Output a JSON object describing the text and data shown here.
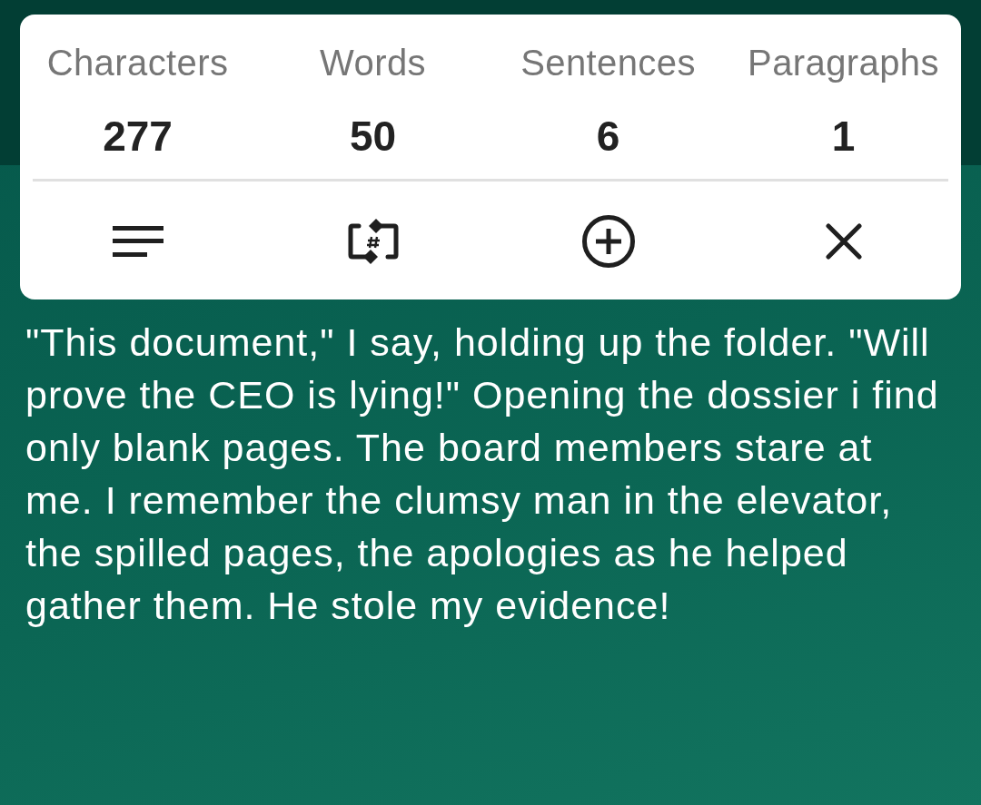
{
  "stats": [
    {
      "label": "Characters",
      "value": "277"
    },
    {
      "label": "Words",
      "value": "50"
    },
    {
      "label": "Sentences",
      "value": "6"
    },
    {
      "label": "Paragraphs",
      "value": "1"
    }
  ],
  "actions": [
    {
      "kind": "lines"
    },
    {
      "kind": "hash-swap"
    },
    {
      "kind": "add"
    },
    {
      "kind": "close"
    }
  ],
  "text": "\"This document,\" I say, holding up the folder. \"Will prove the CEO is lying!\" Opening the dossier i find only blank pages. The board members stare at me. I remember the clumsy man in the elevator, the spilled pages, the apologies as he helped gather them. He stole my evidence!"
}
